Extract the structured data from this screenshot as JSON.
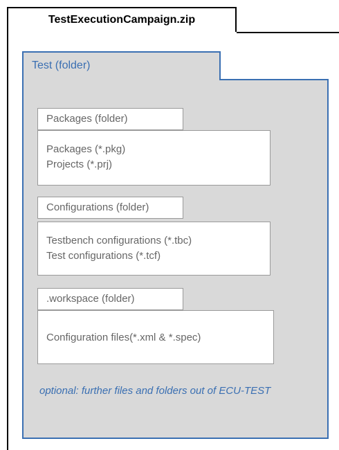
{
  "zip": {
    "title": "TestExecutionCampaign.zip"
  },
  "test_folder": {
    "label": "Test (folder)"
  },
  "packages": {
    "tab": "Packages (folder)",
    "lines": [
      "Packages (*.pkg)",
      "Projects (*.prj)"
    ]
  },
  "configurations": {
    "tab": "Configurations (folder)",
    "lines": [
      "Testbench configurations (*.tbc)",
      "Test configurations (*.tcf)"
    ]
  },
  "workspace": {
    "tab": ".workspace (folder)",
    "lines": [
      "Configuration files(*.xml & *.spec)"
    ]
  },
  "note": "optional: further files and folders out of ECU-TEST",
  "colors": {
    "accent": "#3a6fb2",
    "folder_fill": "#d9d9d9",
    "box_border": "#999999",
    "text_gray": "#666666"
  }
}
